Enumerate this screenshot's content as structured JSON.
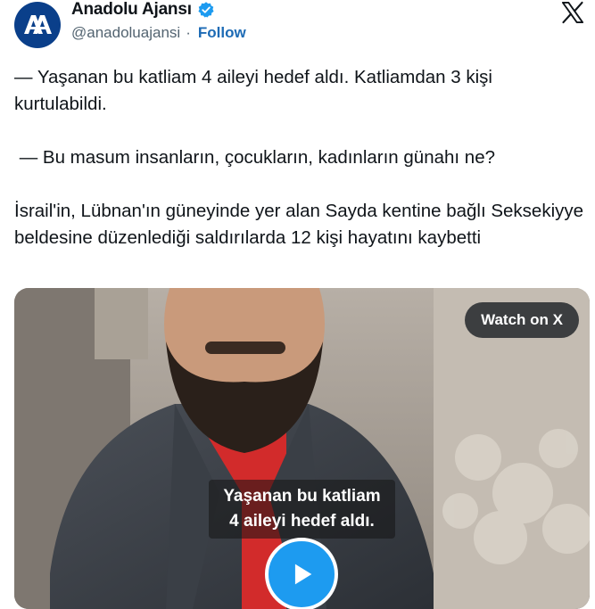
{
  "account": {
    "name": "Anadolu Ajansı",
    "handle": "@anadoluajansi",
    "separator": "·",
    "follow_label": "Follow",
    "avatar_logo_text": "AA"
  },
  "icons": {
    "avatar": "anadolu-agency-logo",
    "verified": "verified-badge-icon",
    "platform": "x-logo-icon",
    "play": "play-icon"
  },
  "colors": {
    "follow": "#1d6bb5",
    "verified": "#1d9bf0",
    "avatar_bg": "#0a3f8a",
    "play_button": "#1d9bf0"
  },
  "tweet": {
    "paragraphs": [
      "— Yaşanan bu katliam 4 aileyi hedef aldı. Katliamdan 3 kişi kurtulabildi.",
      " — Bu masum insanların, çocukların, kadınların günahı ne?",
      "İsrail'in, Lübnan'ın güneyinde yer alan Sayda kentine bağlı Seksekiyye beldesine düzenlediği saldırılarda 12 kişi hayatını kaybetti"
    ]
  },
  "media": {
    "watch_label": "Watch on X",
    "caption_line1": "Yaşanan bu katliam",
    "caption_line2": "4 aileyi hedef aldı."
  }
}
